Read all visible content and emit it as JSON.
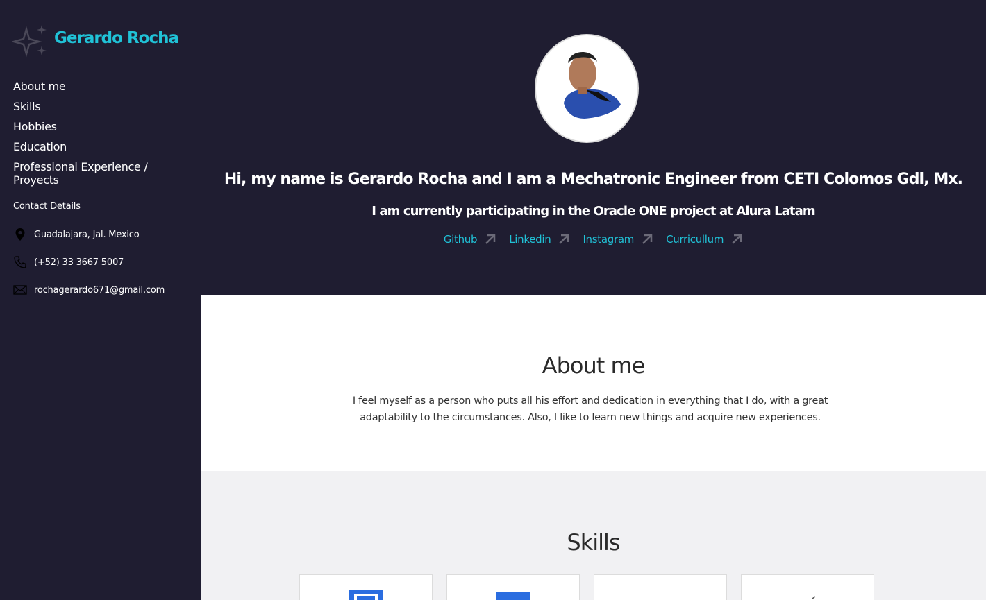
{
  "sidebar": {
    "brand_name": "Gerardo Rocha",
    "brand_icon": "sparkles-icon",
    "nav": [
      {
        "label": "About me"
      },
      {
        "label": "Skills"
      },
      {
        "label": "Hobbies"
      },
      {
        "label": "Education"
      },
      {
        "label": "Professional Experience / Proyects"
      }
    ],
    "contact_title": "Contact Details",
    "contacts": [
      {
        "icon": "location-pin-icon",
        "text": "Guadalajara, Jal. Mexico"
      },
      {
        "icon": "phone-icon",
        "text": "(+52) 33 3667 5007"
      },
      {
        "icon": "mail-icon",
        "text": "rochagerardo671@gmail.com"
      }
    ]
  },
  "hero": {
    "title": "Hi, my name is Gerardo Rocha and I am a Mechatronic Engineer from CETI Colomos Gdl, Mx.",
    "subtitle": "I am currently participating in the Oracle ONE project at Alura Latam",
    "links": [
      {
        "label": "Github"
      },
      {
        "label": "Linkedin"
      },
      {
        "label": "Instagram"
      },
      {
        "label": "Curricullum"
      }
    ]
  },
  "about": {
    "title": "About me",
    "text": "I feel myself as a person who puts all his effort and dedication in everything that I do, with a great adaptability to the circumstances. Also, I like to learn new things and acquire new experiences."
  },
  "skills": {
    "title": "Skills"
  },
  "colors": {
    "accent": "#20c2d7",
    "background_dark": "#1f1d31"
  }
}
